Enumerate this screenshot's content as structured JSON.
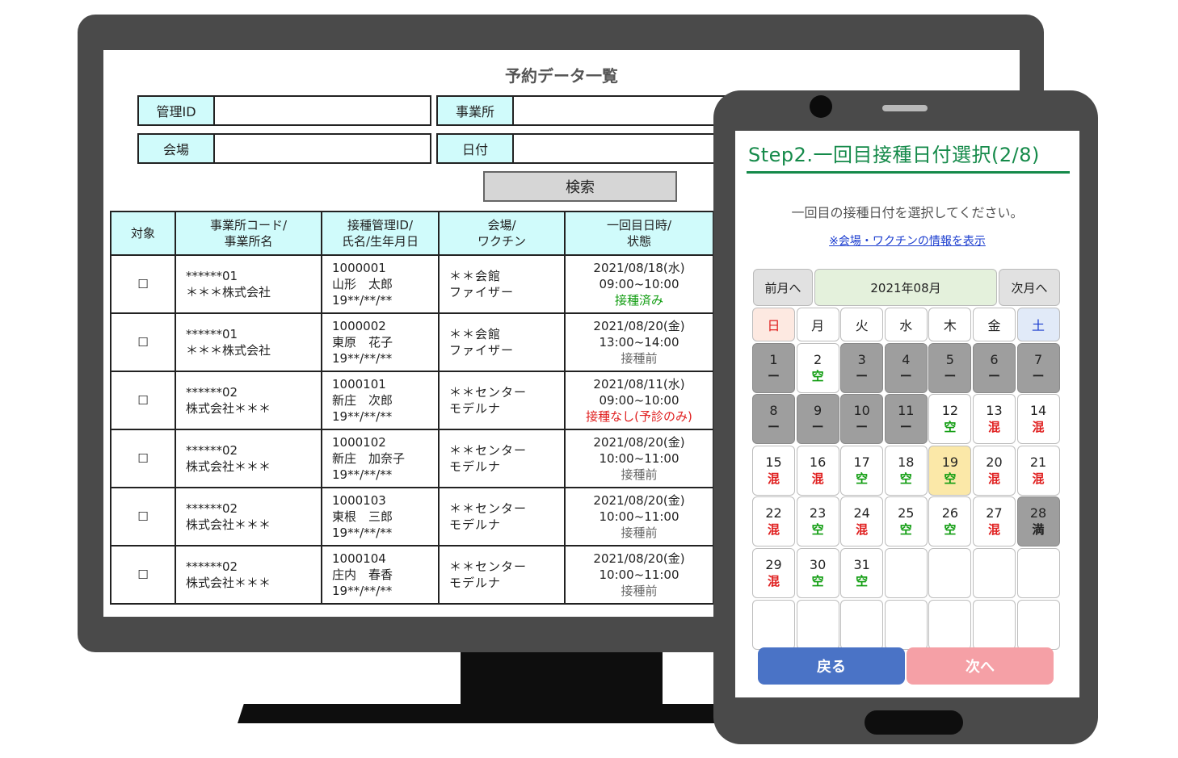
{
  "desktop": {
    "title": "予約データ一覧",
    "filters": {
      "admin_id": "管理ID",
      "office": "事業所",
      "venue": "会場",
      "date": "日付"
    },
    "search_label": "検索",
    "columns": [
      "対象",
      "事業所コード/\n事業所名",
      "接種管理ID/\n氏名/生年月日",
      "会場/\nワクチン",
      "一回目日時/\n状態"
    ],
    "checkbox_glyph": "☐",
    "rows": [
      {
        "code": "******01",
        "office": "＊＊＊株式会社",
        "id": "1000001",
        "name": "山形　太郎",
        "birth": "19**/**/**",
        "venue": "＊＊会館",
        "vaccine": "ファイザー",
        "datetime": "2021/08/18(水)",
        "time": "09:00~10:00",
        "status": "接種済み",
        "status_type": "done"
      },
      {
        "code": "******01",
        "office": "＊＊＊株式会社",
        "id": "1000002",
        "name": "東原　花子",
        "birth": "19**/**/**",
        "venue": "＊＊会館",
        "vaccine": "ファイザー",
        "datetime": "2021/08/20(金)",
        "time": "13:00~14:00",
        "status": "接種前",
        "status_type": "pre"
      },
      {
        "code": "******02",
        "office": "株式会社＊＊＊",
        "id": "1000101",
        "name": "新庄　次郎",
        "birth": "19**/**/**",
        "venue": "＊＊センター",
        "vaccine": "モデルナ",
        "datetime": "2021/08/11(水)",
        "time": "09:00~10:00",
        "status": "接種なし(予診のみ)",
        "status_type": "none"
      },
      {
        "code": "******02",
        "office": "株式会社＊＊＊",
        "id": "1000102",
        "name": "新庄　加奈子",
        "birth": "19**/**/**",
        "venue": "＊＊センター",
        "vaccine": "モデルナ",
        "datetime": "2021/08/20(金)",
        "time": "10:00~11:00",
        "status": "接種前",
        "status_type": "pre"
      },
      {
        "code": "******02",
        "office": "株式会社＊＊＊",
        "id": "1000103",
        "name": "東根　三郎",
        "birth": "19**/**/**",
        "venue": "＊＊センター",
        "vaccine": "モデルナ",
        "datetime": "2021/08/20(金)",
        "time": "10:00~11:00",
        "status": "接種前",
        "status_type": "pre"
      },
      {
        "code": "******02",
        "office": "株式会社＊＊＊",
        "id": "1000104",
        "name": "庄内　春香",
        "birth": "19**/**/**",
        "venue": "＊＊センター",
        "vaccine": "モデルナ",
        "datetime": "2021/08/20(金)",
        "time": "10:00~11:00",
        "status": "接種前",
        "status_type": "pre"
      }
    ]
  },
  "tablet": {
    "step_title": "Step2.一回目接種日付選択(2/8)",
    "instruction": "一回目の接種日付を選択してください。",
    "info_link": "※会場・ワクチンの情報を表示",
    "prev_month": "前月へ",
    "month": "2021年08月",
    "next_month": "次月へ",
    "weekdays": [
      "日",
      "月",
      "火",
      "水",
      "木",
      "金",
      "土"
    ],
    "days": [
      {
        "day": "1",
        "status": "ー",
        "type": "none"
      },
      {
        "day": "2",
        "status": "空",
        "type": "avail"
      },
      {
        "day": "3",
        "status": "ー",
        "type": "none"
      },
      {
        "day": "4",
        "status": "ー",
        "type": "none"
      },
      {
        "day": "5",
        "status": "ー",
        "type": "none"
      },
      {
        "day": "6",
        "status": "ー",
        "type": "none"
      },
      {
        "day": "7",
        "status": "ー",
        "type": "none"
      },
      {
        "day": "8",
        "status": "ー",
        "type": "none"
      },
      {
        "day": "9",
        "status": "ー",
        "type": "none"
      },
      {
        "day": "10",
        "status": "ー",
        "type": "none"
      },
      {
        "day": "11",
        "status": "ー",
        "type": "none"
      },
      {
        "day": "12",
        "status": "空",
        "type": "avail"
      },
      {
        "day": "13",
        "status": "混",
        "type": "busy"
      },
      {
        "day": "14",
        "status": "混",
        "type": "busy"
      },
      {
        "day": "15",
        "status": "混",
        "type": "busy"
      },
      {
        "day": "16",
        "status": "混",
        "type": "busy"
      },
      {
        "day": "17",
        "status": "空",
        "type": "avail"
      },
      {
        "day": "18",
        "status": "空",
        "type": "avail"
      },
      {
        "day": "19",
        "status": "空",
        "type": "avail",
        "selected": true
      },
      {
        "day": "20",
        "status": "混",
        "type": "busy"
      },
      {
        "day": "21",
        "status": "混",
        "type": "busy"
      },
      {
        "day": "22",
        "status": "混",
        "type": "busy"
      },
      {
        "day": "23",
        "status": "空",
        "type": "avail"
      },
      {
        "day": "24",
        "status": "混",
        "type": "busy"
      },
      {
        "day": "25",
        "status": "空",
        "type": "avail"
      },
      {
        "day": "26",
        "status": "空",
        "type": "avail"
      },
      {
        "day": "27",
        "status": "混",
        "type": "busy"
      },
      {
        "day": "28",
        "status": "満",
        "type": "full"
      },
      {
        "day": "29",
        "status": "混",
        "type": "busy"
      },
      {
        "day": "30",
        "status": "空",
        "type": "avail"
      },
      {
        "day": "31",
        "status": "空",
        "type": "avail"
      }
    ],
    "back_label": "戻る",
    "next_label": "次へ"
  }
}
